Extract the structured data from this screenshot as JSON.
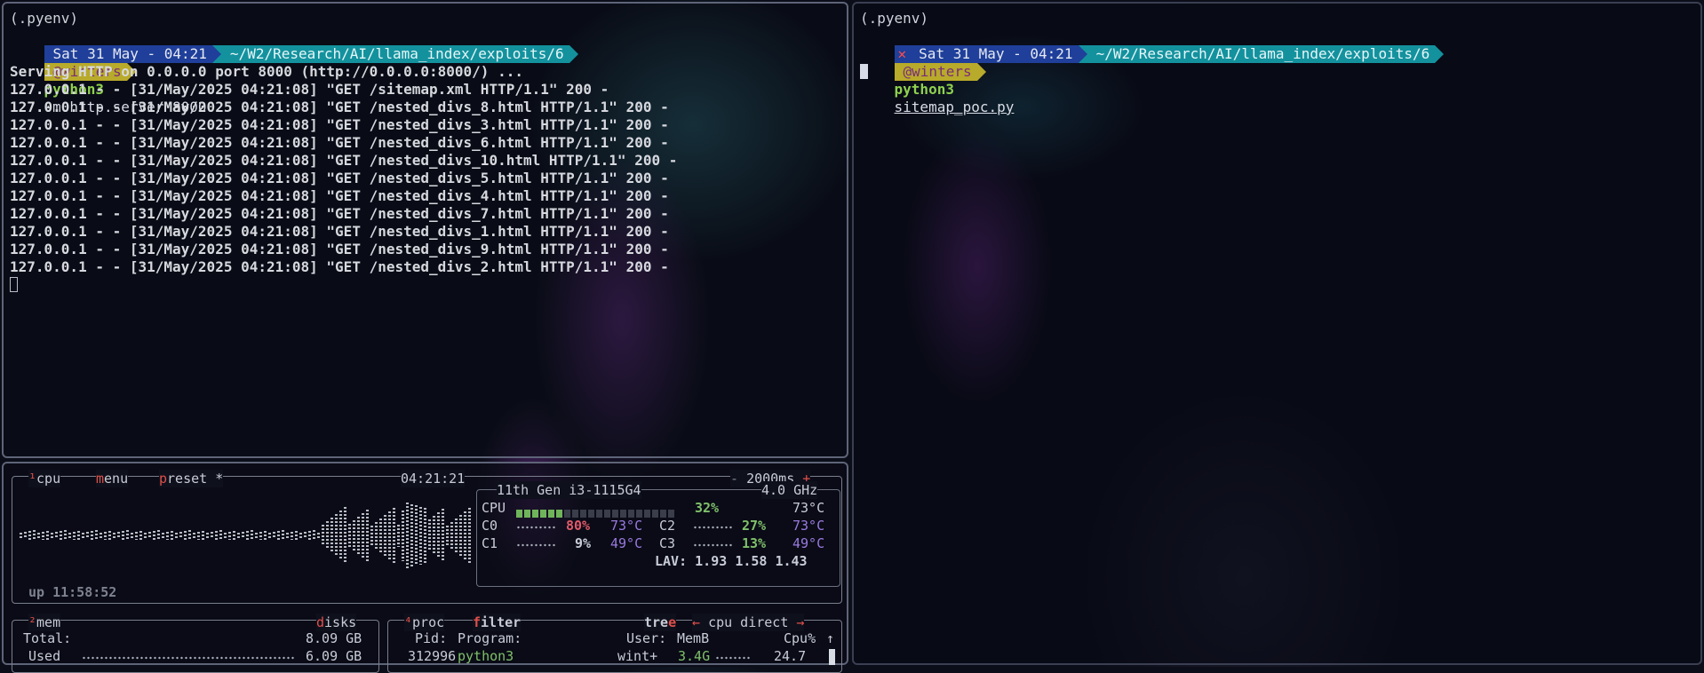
{
  "left_terminal": {
    "venv": "(.pyenv)",
    "prompt": {
      "date": "Sat 31 May - 04:21",
      "path": "~/W2/Research/AI/llama_index/exploits/6",
      "user": "@winters"
    },
    "command": {
      "program": "python3",
      "args": "-m http.server 8000"
    },
    "serving": "Serving HTTP on 0.0.0.0 port 8000 (http://0.0.0.0:8000/) ...",
    "log": [
      "127.0.0.1 - - [31/May/2025 04:21:08] \"GET /sitemap.xml HTTP/1.1\" 200 -",
      "127.0.0.1 - - [31/May/2025 04:21:08] \"GET /nested_divs_8.html HTTP/1.1\" 200 -",
      "127.0.0.1 - - [31/May/2025 04:21:08] \"GET /nested_divs_3.html HTTP/1.1\" 200 -",
      "127.0.0.1 - - [31/May/2025 04:21:08] \"GET /nested_divs_6.html HTTP/1.1\" 200 -",
      "127.0.0.1 - - [31/May/2025 04:21:08] \"GET /nested_divs_10.html HTTP/1.1\" 200 -",
      "127.0.0.1 - - [31/May/2025 04:21:08] \"GET /nested_divs_5.html HTTP/1.1\" 200 -",
      "127.0.0.1 - - [31/May/2025 04:21:08] \"GET /nested_divs_4.html HTTP/1.1\" 200 -",
      "127.0.0.1 - - [31/May/2025 04:21:08] \"GET /nested_divs_7.html HTTP/1.1\" 200 -",
      "127.0.0.1 - - [31/May/2025 04:21:08] \"GET /nested_divs_1.html HTTP/1.1\" 200 -",
      "127.0.0.1 - - [31/May/2025 04:21:08] \"GET /nested_divs_9.html HTTP/1.1\" 200 -",
      "127.0.0.1 - - [31/May/2025 04:21:08] \"GET /nested_divs_2.html HTTP/1.1\" 200 -"
    ]
  },
  "right_terminal": {
    "venv": "(.pyenv)",
    "prompt": {
      "status": "✕",
      "date": "Sat 31 May - 04:21",
      "path": "~/W2/Research/AI/llama_index/exploits/6",
      "user": "@winters"
    },
    "command": {
      "program": "python3",
      "args": "sitemap_poc.py"
    }
  },
  "btop": {
    "cpu_box": {
      "tab_num": "¹",
      "tab_cpu": "cpu",
      "menu_m": "m",
      "menu_rest": "enu",
      "preset_p": "p",
      "preset_rest": "reset *",
      "time": "04:21:21",
      "interval_minus": "-",
      "interval": "2000ms",
      "interval_plus": "+",
      "uptime": "up 11:58:52",
      "cpu_model": "11th Gen i3-1115G4",
      "freq": "4.0 GHz",
      "total_label": "CPU",
      "total_pct": "32%",
      "total_temp": "73°C",
      "total_bar_fraction": 0.32,
      "cores": [
        {
          "label": "C0",
          "pct": "80%",
          "temp": "73°C"
        },
        {
          "label": "C1",
          "pct": "9%",
          "temp": "49°C"
        },
        {
          "label": "C2",
          "pct": "27%",
          "temp": "73°C"
        },
        {
          "label": "C3",
          "pct": "13%",
          "temp": "49°C"
        }
      ],
      "lav_label": "LAV:",
      "lav": [
        "1.93",
        "1.58",
        "1.43"
      ]
    },
    "mem_box": {
      "tab_num": "²",
      "title": "mem",
      "disks_d": "d",
      "disks_rest": "isks",
      "total_label": "Total:",
      "total_value": "8.09 GB",
      "used_label": "Used",
      "used_value": "6.09 GB"
    },
    "proc_box": {
      "tab_num": "⁴",
      "title": "proc",
      "filter_f": "f",
      "filter_rest": "ilter",
      "tree": "tre",
      "tree_e": "e",
      "sort_left": "←",
      "sort": "cpu direct",
      "sort_right": "→",
      "headers": {
        "pid": "Pid:",
        "program": "Program:",
        "user": "User:",
        "mem": "MemB",
        "cpu": "Cpu%",
        "arrow": "↑"
      },
      "rows": [
        {
          "pid": "312996",
          "program": "python3",
          "user": "wint+",
          "mem": "3.4G",
          "cpu": "24.7"
        }
      ]
    }
  }
}
